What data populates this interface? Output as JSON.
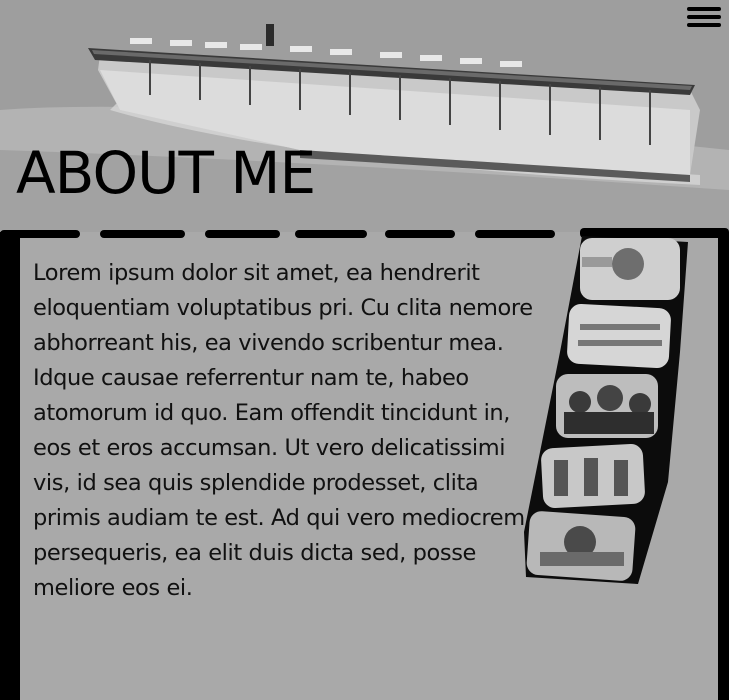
{
  "hero": {
    "title": "ABOUT ME",
    "image": "aircraft-carrier-photo"
  },
  "menu": {
    "icon": "hamburger-menu-icon"
  },
  "content": {
    "paragraph": "Lorem ipsum dolor sit amet, ea hendrerit eloquentiam voluptatibus pri. Cu clita nemore abhorreant his, ea vivendo scribentur mea. Idque causae referrentur nam te, habeo atomorum id quo. Eam offendit tincidunt in, eos et eros accumsan. Ut vero delicatissimi vis, id sea quis splendide prodesset, clita primis audiam te est. Ad qui vero mediocrem persequeris, ea elit duis dicta sed, posse meliore eos ei."
  },
  "filmstrip": {
    "frames": [
      "naval-officer-photo",
      "sailors-formation-photo",
      "officers-group-photo",
      "ceremony-photo",
      "ship-deck-photo"
    ]
  },
  "colors": {
    "panel_bg": "#a9a9a9",
    "border": "#000000",
    "text": "#111111"
  }
}
